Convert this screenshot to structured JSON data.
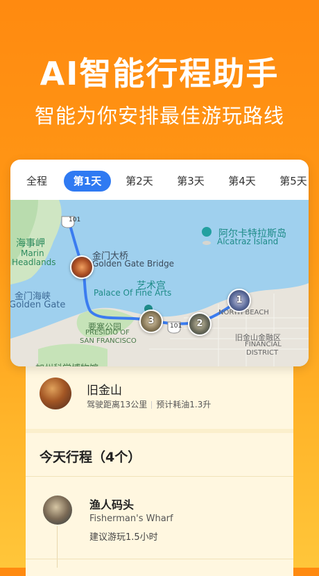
{
  "hero": {
    "title": "AI智能行程助手",
    "subtitle": "智能为你安排最佳游玩路线"
  },
  "tabs": [
    {
      "label": "全程",
      "active": false
    },
    {
      "label": "第1天",
      "active": true
    },
    {
      "label": "第2天",
      "active": false
    },
    {
      "label": "第3天",
      "active": false
    },
    {
      "label": "第4天",
      "active": false
    },
    {
      "label": "第5天",
      "active": false
    }
  ],
  "map": {
    "labels": {
      "marin_cn": "海事岬",
      "marin_en1": "Marin",
      "marin_en2": "Headlands",
      "goldengate_cn": "金门大桥",
      "goldengate_en": "Golden Gate Bridge",
      "gg_strait_cn": "金门海峡",
      "gg_strait_en": "Golden Gate",
      "palace_cn": "艺术宫",
      "palace_en": "Palace Of Fine Arts",
      "presidio_cn": "要塞公园",
      "presidio_en1": "PRESIDIO OF",
      "presidio_en2": "SAN FRANCISCO",
      "alcatraz_cn": "阿尔卡特拉斯岛",
      "alcatraz_en": "Alcatraz Island",
      "northbeach": "NORTH BEACH",
      "financial_cn": "旧金山金融区",
      "financial_en1": "FINANCIAL",
      "financial_en2": "DISTRICT",
      "bottom_cut": "加州科学博物馆",
      "route101_top": "101",
      "route101_bottom": "101"
    },
    "pins": [
      {
        "number": "1"
      },
      {
        "number": "2"
      },
      {
        "number": "3"
      }
    ],
    "route_color": "#3b7cf0"
  },
  "city": {
    "name": "旧金山",
    "distance": "驾驶距离13公里",
    "fuel": "预计耗油1.3升"
  },
  "itinerary": {
    "title": "今天行程（4个）",
    "stops": [
      {
        "name": "渔人码头",
        "name_en": "Fisherman's Wharf",
        "duration": "建议游玩1.5小时"
      }
    ]
  },
  "colors": {
    "accent": "#2f7af2",
    "background_top": "#ff8a10",
    "background_bottom": "#ffc63a",
    "sheet": "#fff7e0"
  }
}
